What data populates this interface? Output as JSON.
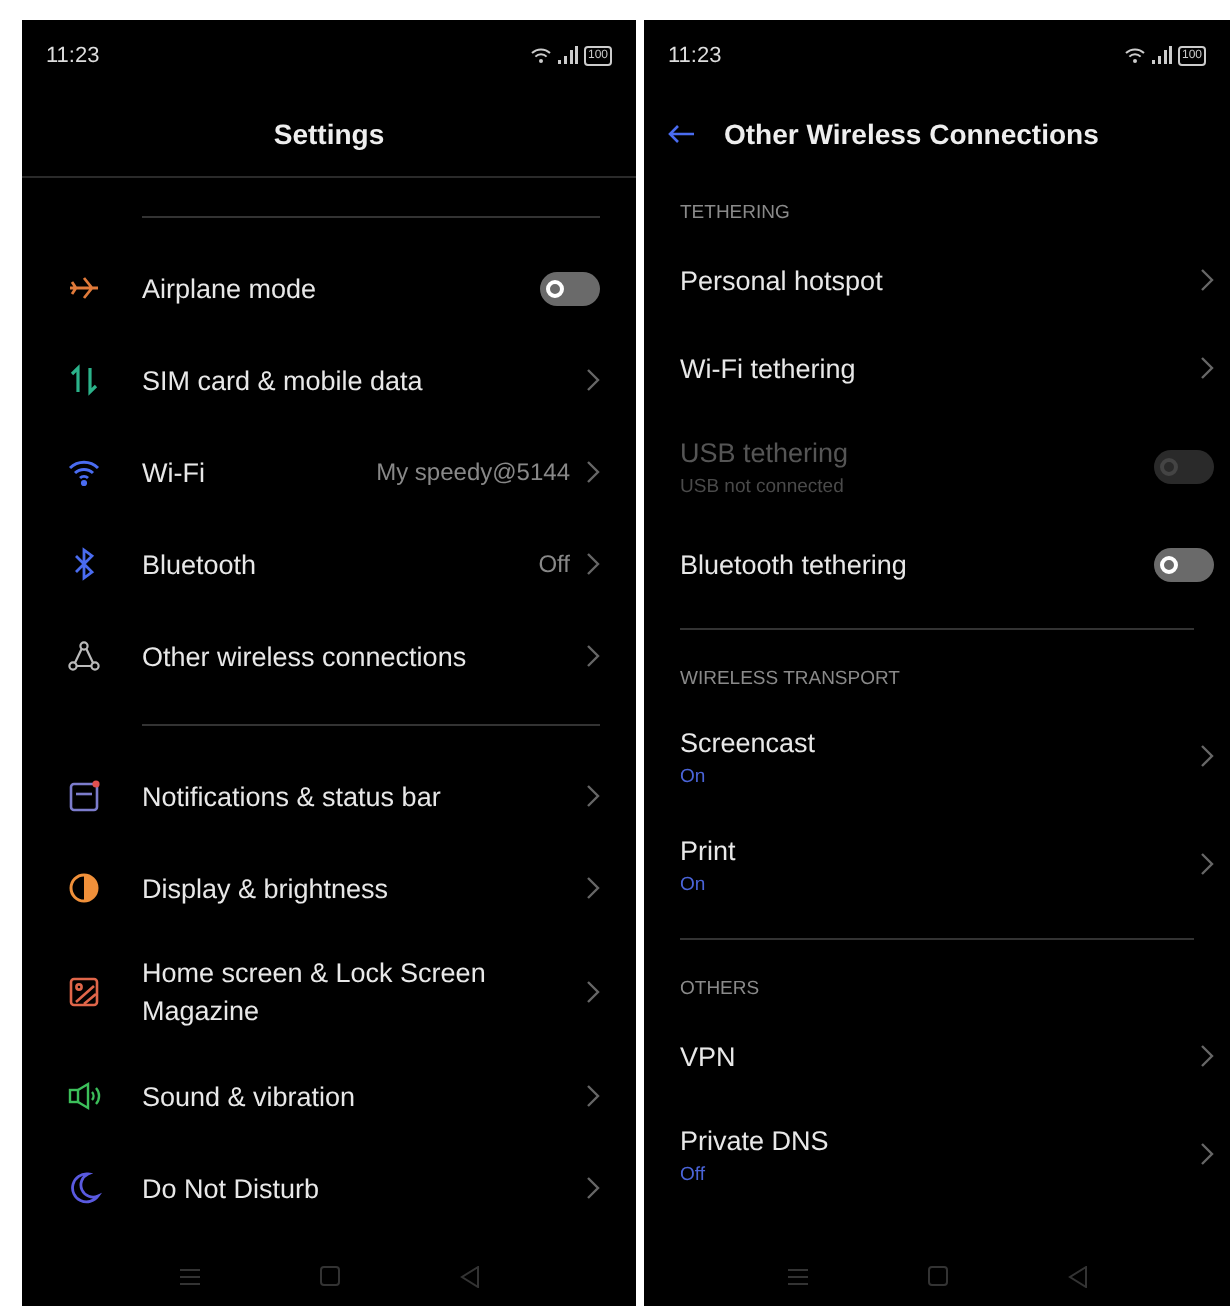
{
  "settings_screen": {
    "status_bar": {
      "time": "11:23",
      "battery": "100"
    },
    "title": "Settings",
    "groups": [
      {
        "items": [
          {
            "label": "Airplane mode",
            "kind": "toggle",
            "on": false
          },
          {
            "label": "SIM card & mobile data",
            "kind": "link"
          },
          {
            "label": "Wi-Fi",
            "kind": "link",
            "value": "My speedy@5144"
          },
          {
            "label": "Bluetooth",
            "kind": "link",
            "value": "Off"
          },
          {
            "label": "Other wireless connections",
            "kind": "link"
          }
        ]
      },
      {
        "items": [
          {
            "label": "Notifications & status bar",
            "kind": "link"
          },
          {
            "label": "Display & brightness",
            "kind": "link"
          },
          {
            "label": "Home screen & Lock Screen Magazine",
            "kind": "link"
          },
          {
            "label": "Sound & vibration",
            "kind": "link"
          },
          {
            "label": "Do Not Disturb",
            "kind": "link"
          }
        ]
      }
    ]
  },
  "wireless_screen": {
    "status_bar": {
      "time": "11:23",
      "battery": "100"
    },
    "title": "Other Wireless Connections",
    "sections": [
      {
        "header": "TETHERING",
        "items": [
          {
            "label": "Personal hotspot",
            "kind": "link"
          },
          {
            "label": "Wi-Fi tethering",
            "kind": "link"
          },
          {
            "label": "USB tethering",
            "kind": "toggle",
            "on": false,
            "disabled": true,
            "subtitle": "USB not connected"
          },
          {
            "label": "Bluetooth tethering",
            "kind": "toggle",
            "on": false,
            "disabled": false
          }
        ]
      },
      {
        "header": "WIRELESS TRANSPORT",
        "items": [
          {
            "label": "Screencast",
            "kind": "link",
            "subtitle": "On"
          },
          {
            "label": "Print",
            "kind": "link",
            "subtitle": "On"
          }
        ]
      },
      {
        "header": "OTHERS",
        "items": [
          {
            "label": "VPN",
            "kind": "link"
          },
          {
            "label": "Private DNS",
            "kind": "link",
            "subtitle": "Off"
          }
        ]
      }
    ]
  }
}
